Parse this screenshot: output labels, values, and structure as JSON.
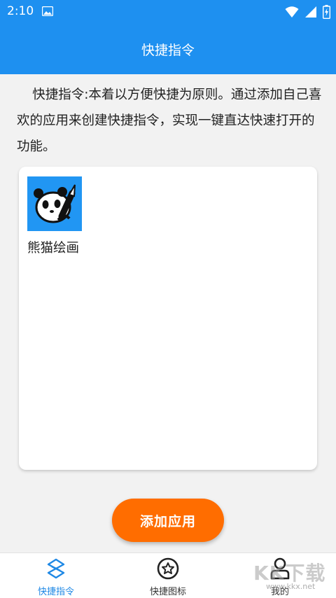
{
  "status_bar": {
    "time": "2:10"
  },
  "app_bar": {
    "title": "快捷指令"
  },
  "intro_text": "快捷指令:本着以方便快捷为原则。通过添加自己喜欢的应用来创建快捷指令，实现一键直达快速打开的功能。",
  "apps": [
    {
      "name": "熊猫绘画",
      "icon": "panda-painting-icon"
    }
  ],
  "add_button": {
    "label": "添加应用"
  },
  "bottom_nav": {
    "items": [
      {
        "label": "快捷指令",
        "icon": "shortcut-icon",
        "active": true
      },
      {
        "label": "快捷图标",
        "icon": "star-badge-icon",
        "active": false
      },
      {
        "label": "我的",
        "icon": "profile-icon",
        "active": false
      }
    ]
  },
  "watermark": {
    "text": "KK下载",
    "sub": "www.kkx.net"
  },
  "colors": {
    "primary": "#1e90f0",
    "accent": "#ff6d00",
    "background": "#f2f2f2"
  }
}
